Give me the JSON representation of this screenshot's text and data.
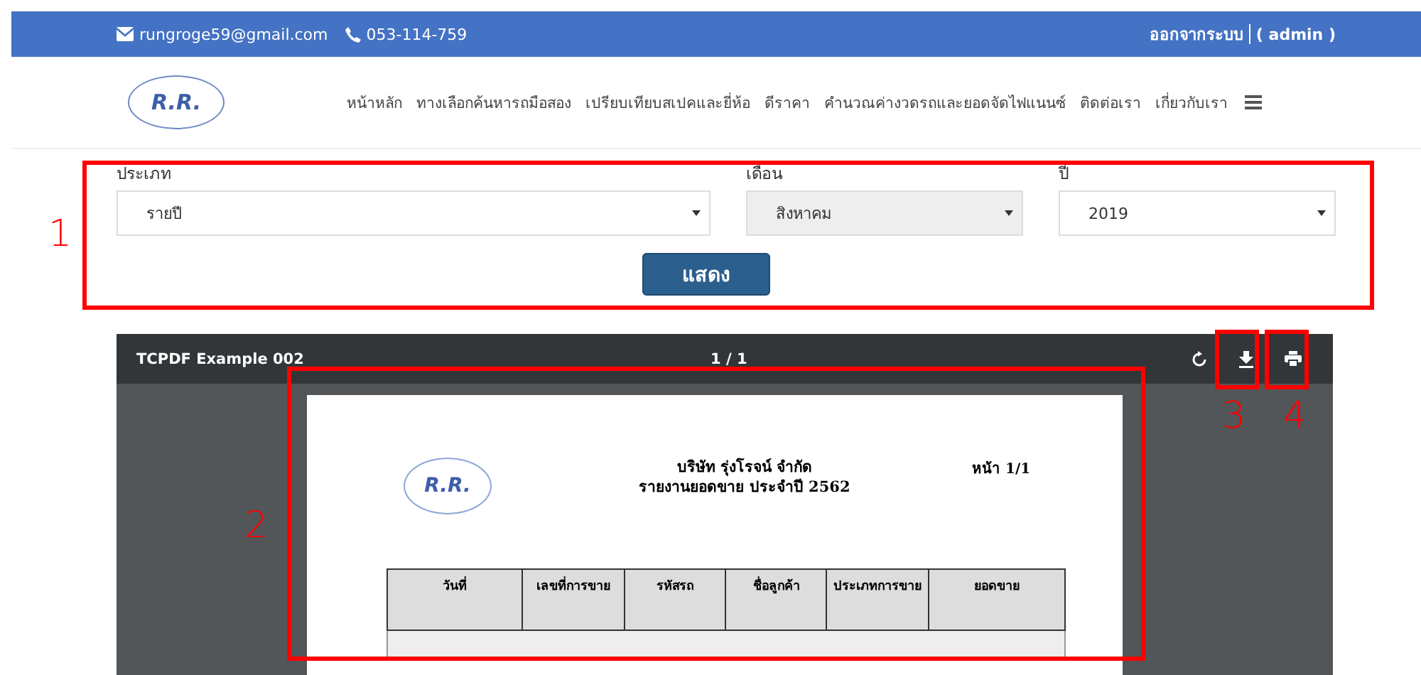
{
  "topbar": {
    "email": "rungroge59@gmail.com",
    "phone": "053-114-759",
    "logout": "ออกจากระบบ",
    "user": "( admin )"
  },
  "logo": {
    "text": "R.R."
  },
  "nav": [
    "หน้าหลัก",
    "ทางเลือกค้นหารถมือสอง",
    "เปรียบเทียบสเปคและยี่ห้อ",
    "ดีราคา",
    "คำนวณค่างวดรถและยอดจัดไฟแนนซ์",
    "ติดต่อเรา",
    "เกี่ยวกับเรา"
  ],
  "filters": [
    {
      "label": "ประเภท",
      "value": "รายปี",
      "disabled": false
    },
    {
      "label": "เดือน",
      "value": "สิงหาคม",
      "disabled": true
    },
    {
      "label": "ปี",
      "value": "2019",
      "disabled": false
    }
  ],
  "show_button": "แสดง",
  "pdf_viewer": {
    "title": "TCPDF Example 002",
    "pages": "1 / 1",
    "document": {
      "logo_text": "R.R.",
      "company": "บริษัท รุ่งโรจน์ จำกัด",
      "report_title": "รายงานยอดขาย ประจำปี 2562",
      "page": "หน้า 1/1",
      "columns": [
        "วันที่",
        "เลขที่การขาย",
        "รหัสรถ",
        "ชื่อลูกค้า",
        "ประเภทการขาย",
        "ยอดขาย"
      ]
    }
  },
  "annotations": [
    "1",
    "2",
    "3",
    "4"
  ]
}
